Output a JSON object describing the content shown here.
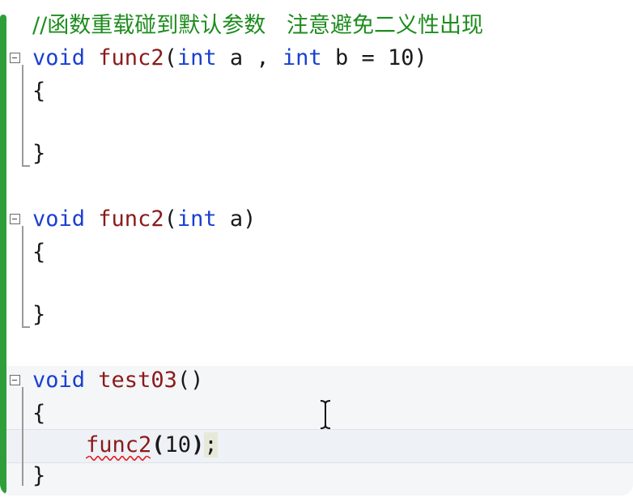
{
  "editor": {
    "comment": "//函数重载碰到默认参数   注意避免二义性出现",
    "blocks": [
      {
        "signature": {
          "keyword": "void",
          "name": "func2",
          "params_pre": "(",
          "params_kw1": "int",
          "params_mid": " a , ",
          "params_kw2": "int",
          "params_post": " b = 10)"
        },
        "open_brace": "{",
        "close_brace": "}"
      },
      {
        "signature": {
          "keyword": "void",
          "name": "func2",
          "params_pre": "(",
          "params_kw1": "int",
          "params_post": " a)"
        },
        "open_brace": "{",
        "close_brace": "}"
      },
      {
        "signature": {
          "keyword": "void",
          "name": "test03",
          "params_post": "()"
        },
        "open_brace": "{",
        "body_call": {
          "name": "func2",
          "open_paren": "(",
          "arg": "10",
          "close_paren": ")",
          "semicolon": ";"
        },
        "close_brace": "}"
      }
    ]
  },
  "colors": {
    "comment": "#1e8c1e",
    "keyword": "#1a3fd0",
    "function": "#8b1a1a",
    "left_bar": "#2e9e3a",
    "error_squiggle": "#e02020"
  }
}
